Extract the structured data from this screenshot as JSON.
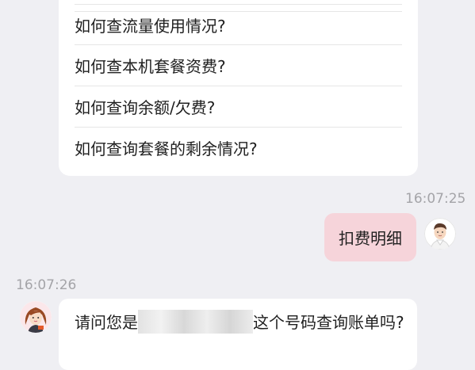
{
  "faq": {
    "items": [
      "如何查流量使用情况?",
      "如何查本机套餐资费?",
      "如何查询余额/欠费?",
      "如何查询套餐的剩余情况?"
    ]
  },
  "user_message": {
    "timestamp": "16:07:25",
    "text": "扣费明细"
  },
  "bot_message": {
    "timestamp": "16:07:26",
    "text_before": "请问您是",
    "text_after": "这个号码查询账单吗?"
  },
  "colors": {
    "background": "#efeff3",
    "user_bubble": "#f6d4da",
    "bot_bubble": "#ffffff"
  }
}
